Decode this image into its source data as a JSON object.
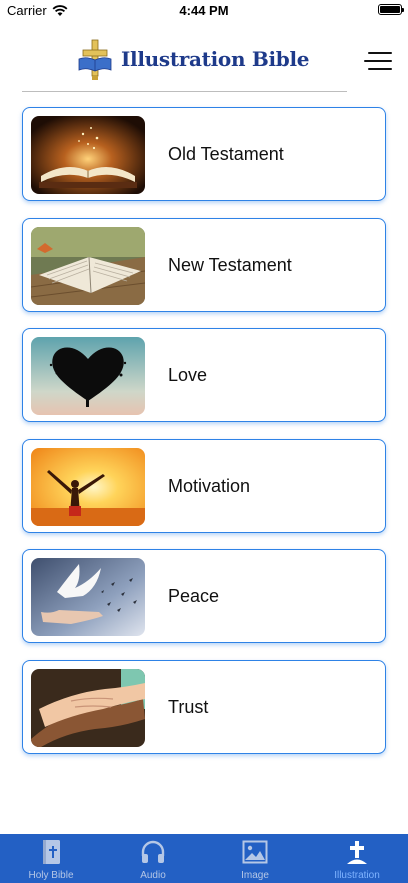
{
  "status_bar": {
    "carrier": "Carrier",
    "time": "4:44 PM"
  },
  "header": {
    "title": "Illustration Bible",
    "logo_icon": "cross-bible-icon",
    "menu_icon": "hamburger-menu-icon"
  },
  "categories": [
    {
      "label": "Old Testament",
      "image": "glowing-open-book-photo"
    },
    {
      "label": "New Testament",
      "image": "open-bible-on-table-photo"
    },
    {
      "label": "Love",
      "image": "heart-shaped-tree-photo"
    },
    {
      "label": "Motivation",
      "image": "person-arms-raised-sunset-photo"
    },
    {
      "label": "Peace",
      "image": "doves-flying-photo"
    },
    {
      "label": "Trust",
      "image": "holding-hands-photo"
    }
  ],
  "tab_bar": {
    "tabs": [
      {
        "label": "Holy Bible",
        "icon": "bible-book-icon"
      },
      {
        "label": "Audio",
        "icon": "headphones-icon"
      },
      {
        "label": "Image",
        "icon": "picture-icon"
      },
      {
        "label": "Illustration",
        "icon": "cross-icon"
      }
    ],
    "active": "Illustration"
  },
  "colors": {
    "accent": "#2e82e6",
    "tab_bar": "#2360c4",
    "title": "#1e3a8a",
    "active_tab": "#7fb3ff"
  }
}
